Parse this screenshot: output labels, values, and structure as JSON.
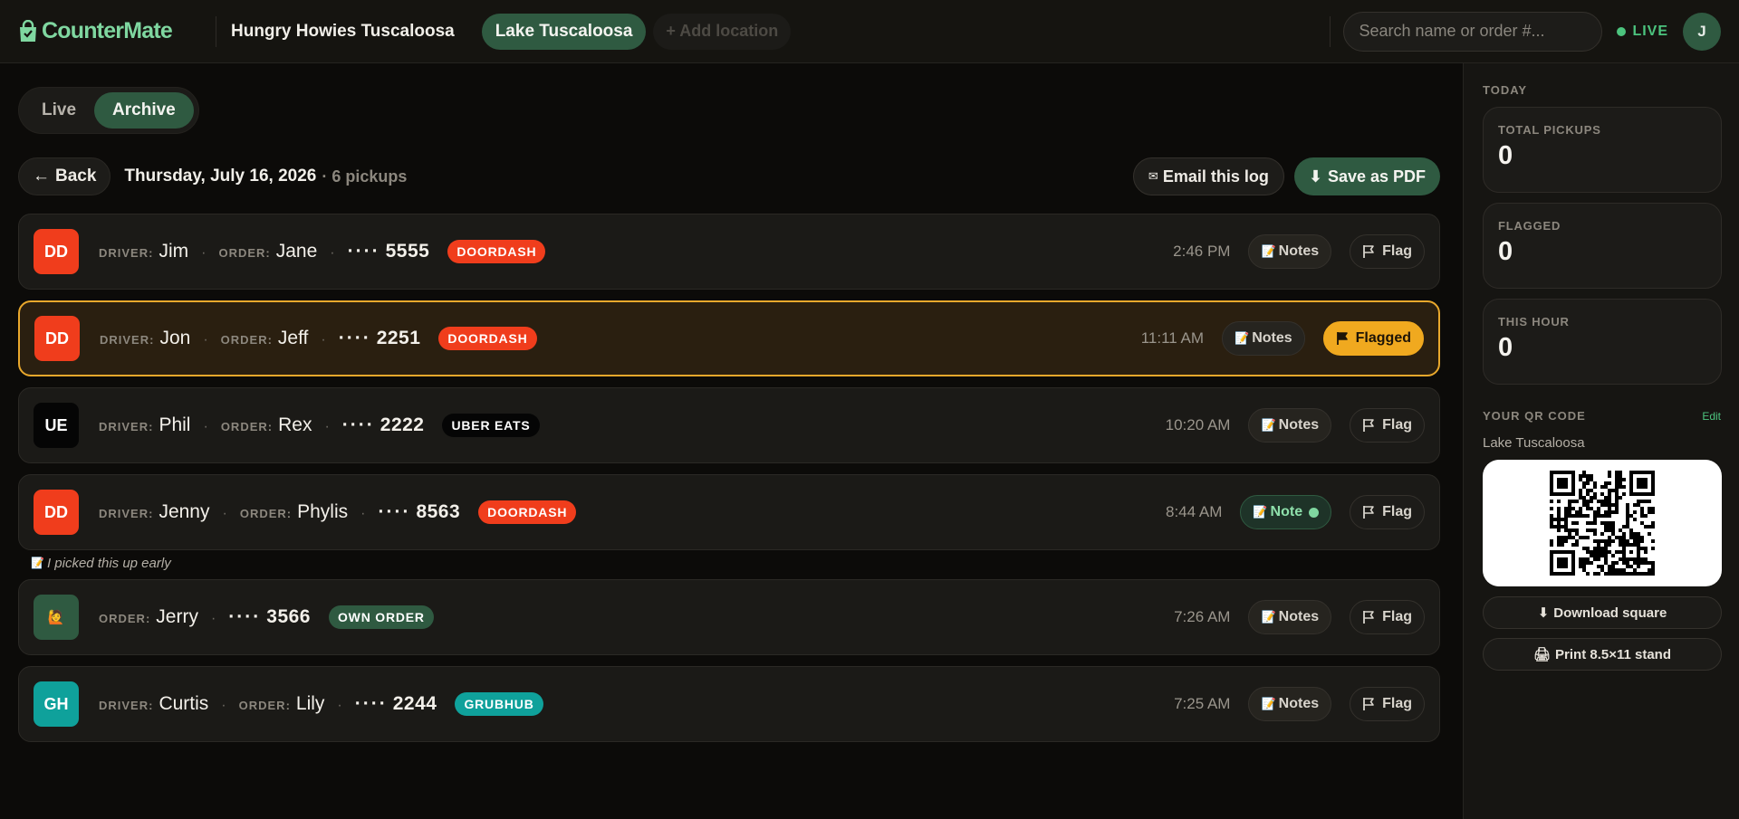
{
  "header": {
    "brand": "CounterMate",
    "business_name": "Hungry Howies Tuscaloosa",
    "location": "Lake Tuscaloosa",
    "add_location": "+ Add location",
    "search_placeholder": "Search name or order #...",
    "live_label": "LIVE",
    "avatar_initial": "J"
  },
  "view_toggle": {
    "live": "Live",
    "archive": "Archive",
    "selected": "Archive"
  },
  "log": {
    "back": "Back",
    "date": "Thursday, July 16, 2026",
    "count": "· 6 pickups",
    "email_button": "Email this log",
    "pdf_button": "Save as PDF"
  },
  "labels": {
    "driver": "DRIVER:",
    "order": "ORDER:",
    "mask": "····"
  },
  "pickups": [
    {
      "badge": "DD",
      "badge_color": "#f03d1c",
      "driver": "Jim",
      "order": "Jane",
      "last4": "5555",
      "service": "DOORDASH",
      "service_color": "#f03d1c",
      "time": "2:46 PM",
      "notes_label": "Notes",
      "has_note": false,
      "flag_label": "Flag",
      "flagged": false
    },
    {
      "badge": "DD",
      "badge_color": "#f03d1c",
      "driver": "Jon",
      "order": "Jeff",
      "last4": "2251",
      "service": "DOORDASH",
      "service_color": "#f03d1c",
      "time": "11:11 AM",
      "notes_label": "Notes",
      "has_note": false,
      "flag_label": "Flagged",
      "flagged": true
    },
    {
      "badge": "UE",
      "badge_color": "#050505",
      "driver": "Phil",
      "order": "Rex",
      "last4": "2222",
      "service": "UBER EATS",
      "service_color": "#050505",
      "time": "10:20 AM",
      "notes_label": "Notes",
      "has_note": false,
      "flag_label": "Flag",
      "flagged": false
    },
    {
      "badge": "DD",
      "badge_color": "#f03d1c",
      "driver": "Jenny",
      "order": "Phylis",
      "last4": "8563",
      "service": "DOORDASH",
      "service_color": "#f03d1c",
      "time": "8:44 AM",
      "notes_label": "Note",
      "has_note": true,
      "note_text": "I picked this up early",
      "flag_label": "Flag",
      "flagged": false
    },
    {
      "badge": "🙋",
      "badge_color": "#2f5a41",
      "driver": null,
      "order": "Jerry",
      "last4": "3566",
      "service": "OWN ORDER",
      "service_color": "#2f5a41",
      "time": "7:26 AM",
      "notes_label": "Notes",
      "has_note": false,
      "flag_label": "Flag",
      "flagged": false
    },
    {
      "badge": "GH",
      "badge_color": "#0fa19b",
      "driver": "Curtis",
      "order": "Lily",
      "last4": "2244",
      "service": "GRUBHUB",
      "service_color": "#0fa19b",
      "time": "7:25 AM",
      "notes_label": "Notes",
      "has_note": false,
      "flag_label": "Flag",
      "flagged": false
    }
  ],
  "sidebar": {
    "section_title": "TODAY",
    "stats": [
      {
        "label": "TOTAL PICKUPS",
        "value": "0"
      },
      {
        "label": "FLAGGED",
        "value": "0"
      },
      {
        "label": "THIS HOUR",
        "value": "0"
      }
    ],
    "qr_title": "YOUR QR CODE",
    "qr_edit": "Edit",
    "qr_location": "Lake Tuscaloosa",
    "download_button": "Download square",
    "print_button": "Print 8.5×11 stand"
  },
  "icons": {
    "brand": "shopping-bag-icon",
    "back": "arrow-left-icon",
    "email": "envelope-icon",
    "pdf": "download-icon",
    "notes": "memo-icon",
    "flag": "flag-icon",
    "print": "printer-icon"
  }
}
